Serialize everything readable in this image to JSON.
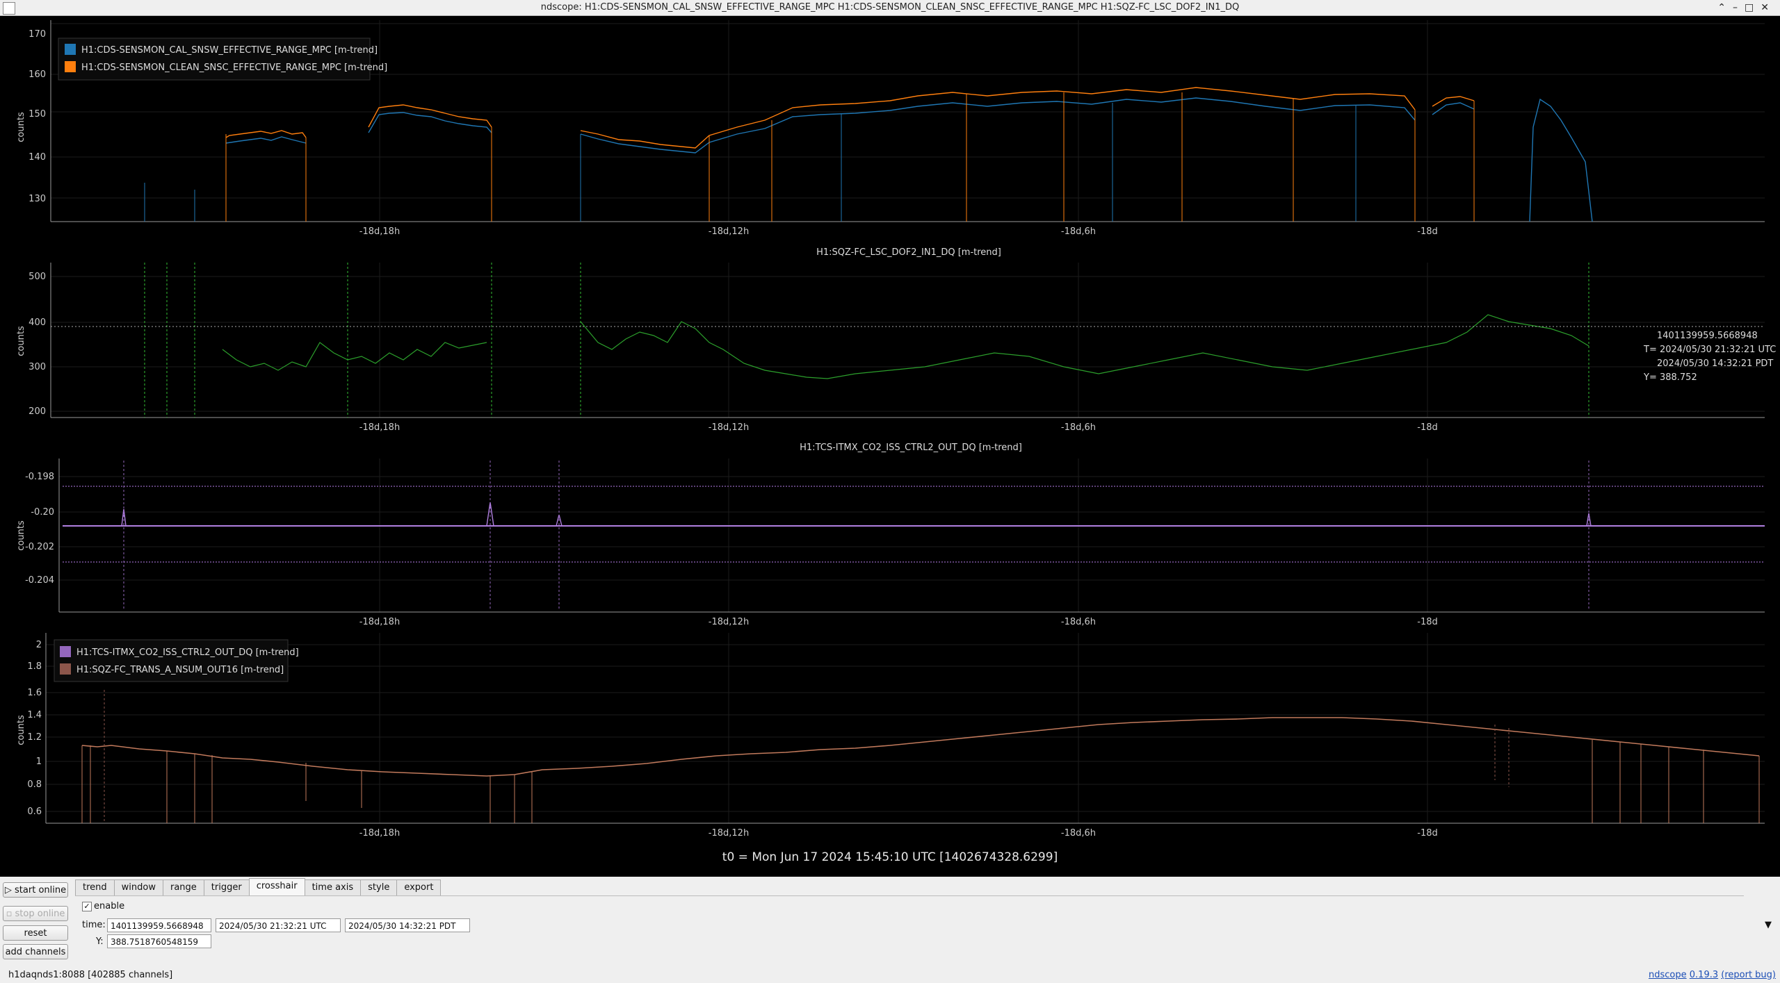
{
  "window": {
    "title": "ndscope: H1:CDS-SENSMON_CAL_SNSW_EFFECTIVE_RANGE_MPC H1:CDS-SENSMON_CLEAN_SNSC_EFFECTIVE_RANGE_MPC H1:SQZ-FC_LSC_DOF2_IN1_DQ"
  },
  "time_axis": {
    "ticks": [
      "-18d,18h",
      "-18d,12h",
      "-18d,6h",
      "-18d"
    ]
  },
  "plots": [
    {
      "ylabel": "counts",
      "title": "",
      "yticks": [
        "170",
        "160",
        "150",
        "140",
        "130"
      ],
      "legend": [
        {
          "name": "H1:CDS-SENSMON_CAL_SNSW_EFFECTIVE_RANGE_MPC [m-trend]",
          "color": "#1f77b4"
        },
        {
          "name": "H1:CDS-SENSMON_CLEAN_SNSC_EFFECTIVE_RANGE_MPC [m-trend]",
          "color": "#ff7f0e"
        }
      ]
    },
    {
      "ylabel": "counts",
      "title": "H1:SQZ-FC_LSC_DOF2_IN1_DQ [m-trend]",
      "yticks": [
        "500",
        "400",
        "300",
        "200"
      ],
      "color": "#2ca02c",
      "crosshair_readout": [
        "1401139959.5668948",
        "T= 2024/05/30 21:32:21 UTC",
        "2024/05/30 14:32:21 PDT",
        "Y= 388.752"
      ]
    },
    {
      "ylabel": "counts",
      "title": "H1:TCS-ITMX_CO2_ISS_CTRL2_OUT_DQ [m-trend]",
      "yticks": [
        "-0.198",
        "-0.20",
        "-0.202",
        "-0.204"
      ],
      "color": "#9467bd"
    },
    {
      "ylabel": "counts",
      "title": "",
      "yticks": [
        "2",
        "1.8",
        "1.6",
        "1.4",
        "1.2",
        "1",
        "0.8",
        "0.6"
      ],
      "legend": [
        {
          "name": "H1:TCS-ITMX_CO2_ISS_CTRL2_OUT_DQ [m-trend]",
          "color": "#9467bd"
        },
        {
          "name": "H1:SQZ-FC_TRANS_A_NSUM_OUT16 [m-trend]",
          "color": "#8c564b"
        }
      ]
    }
  ],
  "t0_label": "t0 = Mon Jun 17 2024 15:45:10 UTC [1402674328.6299]",
  "buttons": {
    "start_online": "start online",
    "stop_online": "stop online",
    "reset": "reset",
    "add_channels": "add channels"
  },
  "tabs": [
    "trend",
    "window",
    "range",
    "trigger",
    "crosshair",
    "time axis",
    "style",
    "export"
  ],
  "crosshair": {
    "enable_label": "enable",
    "enable_checked": "✓",
    "time_label": "time:",
    "gps": "1401139959.5668948",
    "utc": "2024/05/30 21:32:21 UTC",
    "pdt": "2024/05/30 14:32:21 PDT",
    "y_label": "Y:",
    "y_value": "388.7518760548159"
  },
  "status": {
    "server": "h1daqnds1:8088  [402885 channels]",
    "app_name": "ndscope",
    "version": "0.19.3",
    "report_bug": "(report bug)"
  }
}
